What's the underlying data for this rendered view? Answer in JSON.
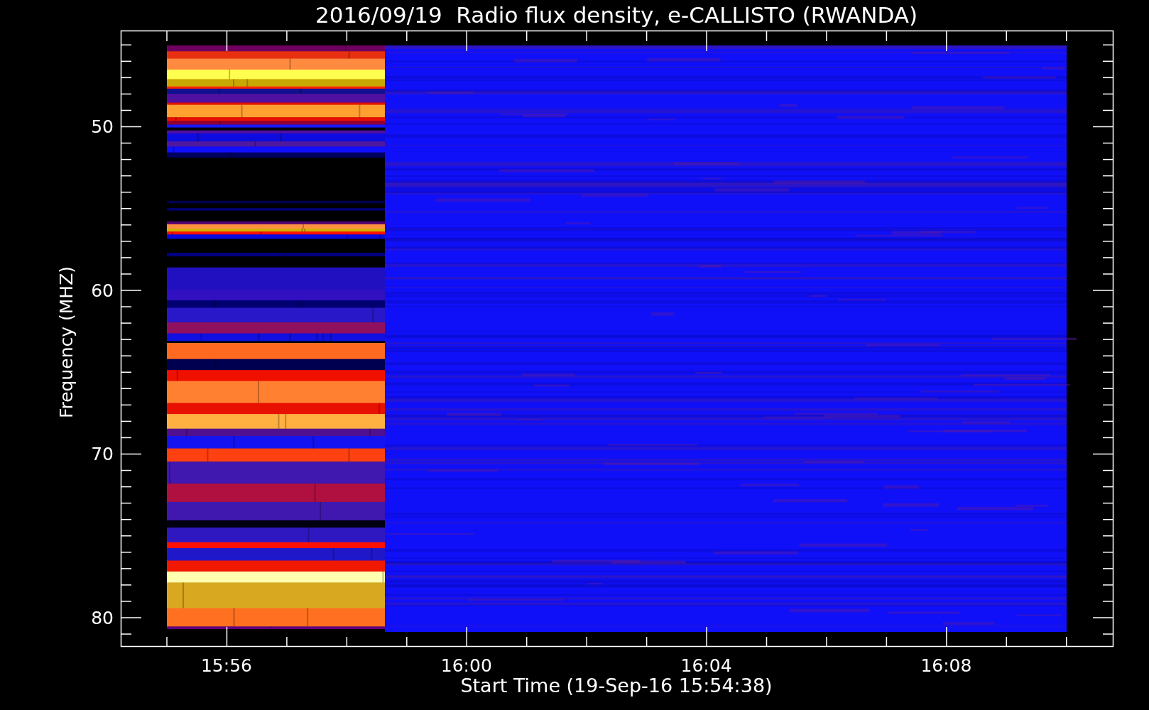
{
  "plot": {
    "title": "2016/09/19  Radio flux density, e-CALLISTO (RWANDA)",
    "xlabel": "Start Time (19-Sep-16 15:54:38)",
    "ylabel": "Frequency (MHZ)",
    "xticks": [
      "15:56",
      "16:00",
      "16:04",
      "16:08"
    ],
    "yticks": [
      "50",
      "60",
      "70",
      "80"
    ]
  }
}
